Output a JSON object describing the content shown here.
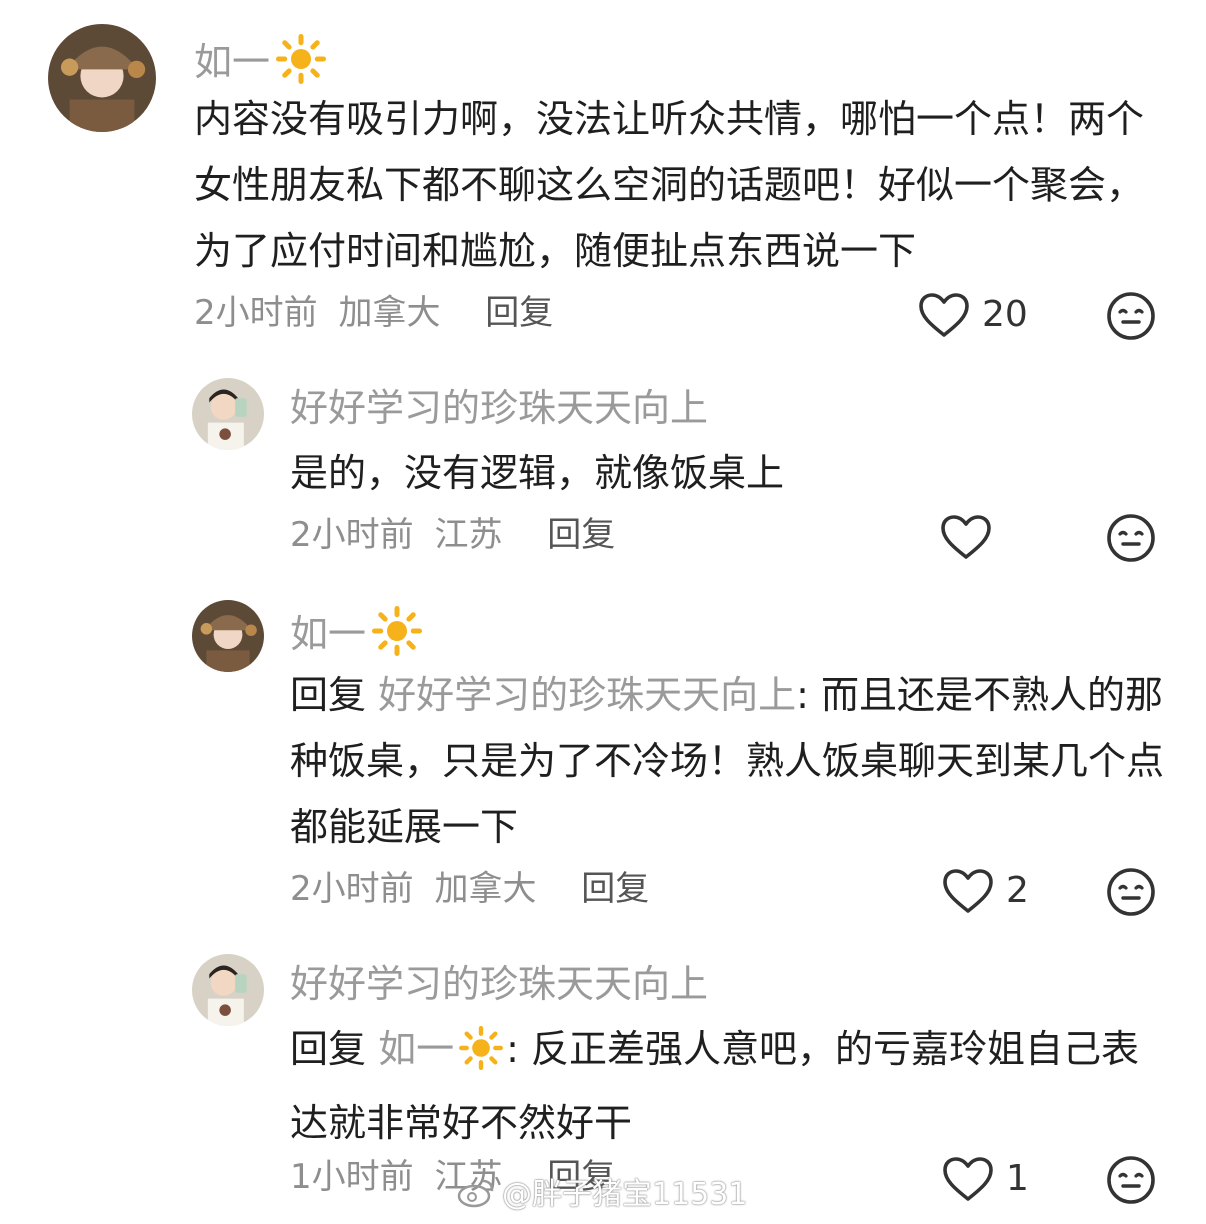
{
  "comments": [
    {
      "username": "如一",
      "text": "内容没有吸引力啊，没法让听众共情，哪怕一个点！两个女性朋友私下都不聊这么空洞的话题吧！好似一个聚会，为了应付时间和尴尬，随便扯点东西说一下",
      "time": "2小时前",
      "location": "加拿大",
      "reply_label": "回复",
      "likes": "20"
    },
    {
      "username": "好好学习的珍珠天天向上",
      "text": "是的，没有逻辑，就像饭桌上",
      "time": "2小时前",
      "location": "江苏",
      "reply_label": "回复",
      "likes": ""
    },
    {
      "username": "如一",
      "reply_prefix": "回复",
      "reply_target": "好好学习的珍珠天天向上",
      "text": ": 而且还是不熟人的那种饭桌，只是为了不冷场！熟人饭桌聊天到某几个点都能延展一下",
      "time": "2小时前",
      "location": "加拿大",
      "reply_label": "回复",
      "likes": "2"
    },
    {
      "username": "好好学习的珍珠天天向上",
      "reply_prefix": "回复",
      "reply_target": "如一",
      "text": ": 反正差强人意吧，的亏嘉玲姐自己表达就非常好不然好干",
      "time": "1小时前",
      "location": "江苏",
      "reply_label": "回复",
      "likes": "1"
    }
  ],
  "watermark": "@胖子猪宝11531",
  "colors": {
    "username": "#9a9a9a",
    "text": "#1f1f1f",
    "meta": "#8e8e8e",
    "sun": "#f6b21a"
  }
}
